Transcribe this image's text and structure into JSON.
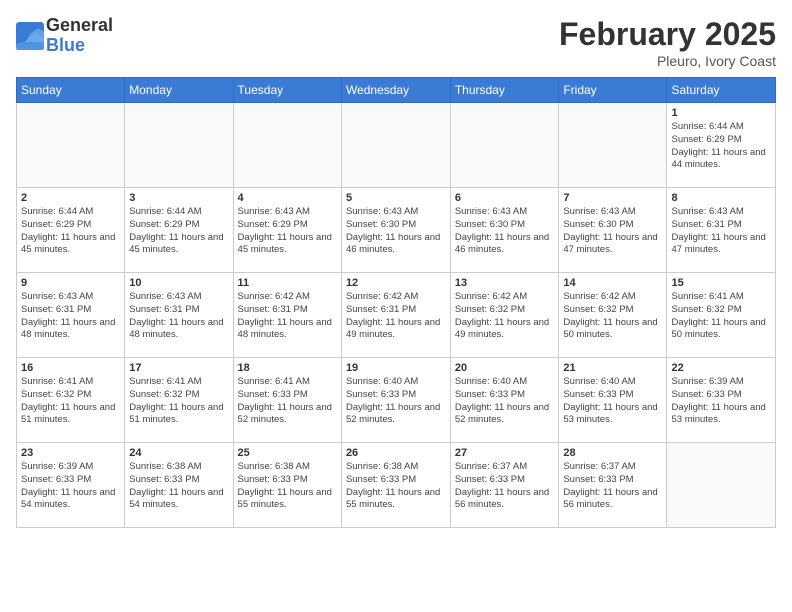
{
  "logo": {
    "general": "General",
    "blue": "Blue"
  },
  "header": {
    "month": "February 2025",
    "location": "Pleuro, Ivory Coast"
  },
  "weekdays": [
    "Sunday",
    "Monday",
    "Tuesday",
    "Wednesday",
    "Thursday",
    "Friday",
    "Saturday"
  ],
  "weeks": [
    [
      {
        "day": "",
        "info": ""
      },
      {
        "day": "",
        "info": ""
      },
      {
        "day": "",
        "info": ""
      },
      {
        "day": "",
        "info": ""
      },
      {
        "day": "",
        "info": ""
      },
      {
        "day": "",
        "info": ""
      },
      {
        "day": "1",
        "info": "Sunrise: 6:44 AM\nSunset: 6:29 PM\nDaylight: 11 hours and 44 minutes."
      }
    ],
    [
      {
        "day": "2",
        "info": "Sunrise: 6:44 AM\nSunset: 6:29 PM\nDaylight: 11 hours and 45 minutes."
      },
      {
        "day": "3",
        "info": "Sunrise: 6:44 AM\nSunset: 6:29 PM\nDaylight: 11 hours and 45 minutes."
      },
      {
        "day": "4",
        "info": "Sunrise: 6:43 AM\nSunset: 6:29 PM\nDaylight: 11 hours and 45 minutes."
      },
      {
        "day": "5",
        "info": "Sunrise: 6:43 AM\nSunset: 6:30 PM\nDaylight: 11 hours and 46 minutes."
      },
      {
        "day": "6",
        "info": "Sunrise: 6:43 AM\nSunset: 6:30 PM\nDaylight: 11 hours and 46 minutes."
      },
      {
        "day": "7",
        "info": "Sunrise: 6:43 AM\nSunset: 6:30 PM\nDaylight: 11 hours and 47 minutes."
      },
      {
        "day": "8",
        "info": "Sunrise: 6:43 AM\nSunset: 6:31 PM\nDaylight: 11 hours and 47 minutes."
      }
    ],
    [
      {
        "day": "9",
        "info": "Sunrise: 6:43 AM\nSunset: 6:31 PM\nDaylight: 11 hours and 48 minutes."
      },
      {
        "day": "10",
        "info": "Sunrise: 6:43 AM\nSunset: 6:31 PM\nDaylight: 11 hours and 48 minutes."
      },
      {
        "day": "11",
        "info": "Sunrise: 6:42 AM\nSunset: 6:31 PM\nDaylight: 11 hours and 48 minutes."
      },
      {
        "day": "12",
        "info": "Sunrise: 6:42 AM\nSunset: 6:31 PM\nDaylight: 11 hours and 49 minutes."
      },
      {
        "day": "13",
        "info": "Sunrise: 6:42 AM\nSunset: 6:32 PM\nDaylight: 11 hours and 49 minutes."
      },
      {
        "day": "14",
        "info": "Sunrise: 6:42 AM\nSunset: 6:32 PM\nDaylight: 11 hours and 50 minutes."
      },
      {
        "day": "15",
        "info": "Sunrise: 6:41 AM\nSunset: 6:32 PM\nDaylight: 11 hours and 50 minutes."
      }
    ],
    [
      {
        "day": "16",
        "info": "Sunrise: 6:41 AM\nSunset: 6:32 PM\nDaylight: 11 hours and 51 minutes."
      },
      {
        "day": "17",
        "info": "Sunrise: 6:41 AM\nSunset: 6:32 PM\nDaylight: 11 hours and 51 minutes."
      },
      {
        "day": "18",
        "info": "Sunrise: 6:41 AM\nSunset: 6:33 PM\nDaylight: 11 hours and 52 minutes."
      },
      {
        "day": "19",
        "info": "Sunrise: 6:40 AM\nSunset: 6:33 PM\nDaylight: 11 hours and 52 minutes."
      },
      {
        "day": "20",
        "info": "Sunrise: 6:40 AM\nSunset: 6:33 PM\nDaylight: 11 hours and 52 minutes."
      },
      {
        "day": "21",
        "info": "Sunrise: 6:40 AM\nSunset: 6:33 PM\nDaylight: 11 hours and 53 minutes."
      },
      {
        "day": "22",
        "info": "Sunrise: 6:39 AM\nSunset: 6:33 PM\nDaylight: 11 hours and 53 minutes."
      }
    ],
    [
      {
        "day": "23",
        "info": "Sunrise: 6:39 AM\nSunset: 6:33 PM\nDaylight: 11 hours and 54 minutes."
      },
      {
        "day": "24",
        "info": "Sunrise: 6:38 AM\nSunset: 6:33 PM\nDaylight: 11 hours and 54 minutes."
      },
      {
        "day": "25",
        "info": "Sunrise: 6:38 AM\nSunset: 6:33 PM\nDaylight: 11 hours and 55 minutes."
      },
      {
        "day": "26",
        "info": "Sunrise: 6:38 AM\nSunset: 6:33 PM\nDaylight: 11 hours and 55 minutes."
      },
      {
        "day": "27",
        "info": "Sunrise: 6:37 AM\nSunset: 6:33 PM\nDaylight: 11 hours and 56 minutes."
      },
      {
        "day": "28",
        "info": "Sunrise: 6:37 AM\nSunset: 6:33 PM\nDaylight: 11 hours and 56 minutes."
      },
      {
        "day": "",
        "info": ""
      }
    ]
  ]
}
